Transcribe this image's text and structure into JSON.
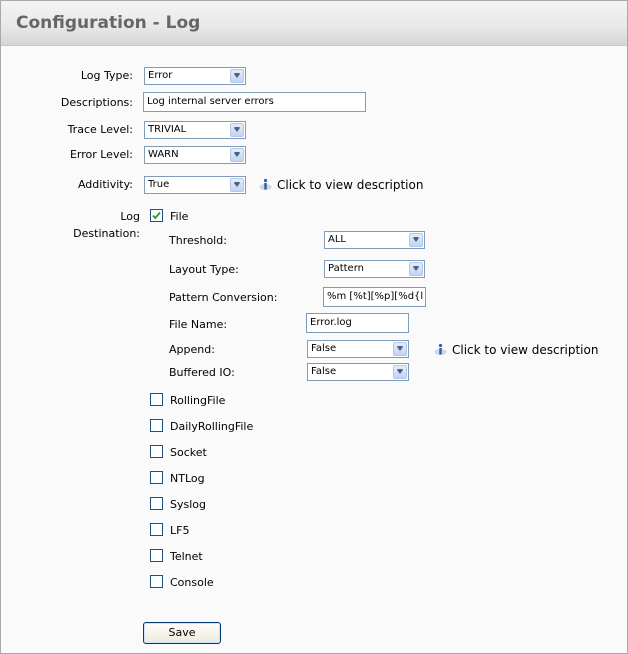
{
  "page": {
    "title": "Configuration - Log"
  },
  "form": {
    "log_type": {
      "label": "Log Type:",
      "value": "Error"
    },
    "descriptions": {
      "label": "Descriptions:",
      "value": "Log internal server errors"
    },
    "trace_level": {
      "label": "Trace Level:",
      "value": "TRIVIAL"
    },
    "error_level": {
      "label": "Error Level:",
      "value": "WARN"
    },
    "additivity": {
      "label": "Additivity:",
      "value": "True",
      "info": "Click to view description"
    },
    "log_destination": {
      "label_line1": "Log",
      "label_line2": "Destination:"
    }
  },
  "file_destination": {
    "label": "File",
    "checked": true,
    "threshold": {
      "label": "Threshold:",
      "value": "ALL"
    },
    "layout_type": {
      "label": "Layout Type:",
      "value": "Pattern"
    },
    "pattern_conversion": {
      "label": "Pattern Conversion:",
      "value": "%m [%t][%p][%d{l"
    },
    "file_name": {
      "label": "File Name:",
      "value": "Error.log"
    },
    "append": {
      "label": "Append:",
      "value": "False",
      "info": "Click to view description"
    },
    "buffered_io": {
      "label": "Buffered IO:",
      "value": "False"
    }
  },
  "other_destinations": [
    {
      "label": "RollingFile",
      "checked": false
    },
    {
      "label": "DailyRollingFile",
      "checked": false
    },
    {
      "label": "Socket",
      "checked": false
    },
    {
      "label": "NTLog",
      "checked": false
    },
    {
      "label": "Syslog",
      "checked": false
    },
    {
      "label": "LF5",
      "checked": false
    },
    {
      "label": "Telnet",
      "checked": false
    },
    {
      "label": "Console",
      "checked": false
    }
  ],
  "actions": {
    "save_label": "Save"
  },
  "colors": {
    "header_text": "#666666",
    "input_border": "#7f9db9",
    "checkbox_border": "#1c5180",
    "check_mark": "#21a121"
  }
}
